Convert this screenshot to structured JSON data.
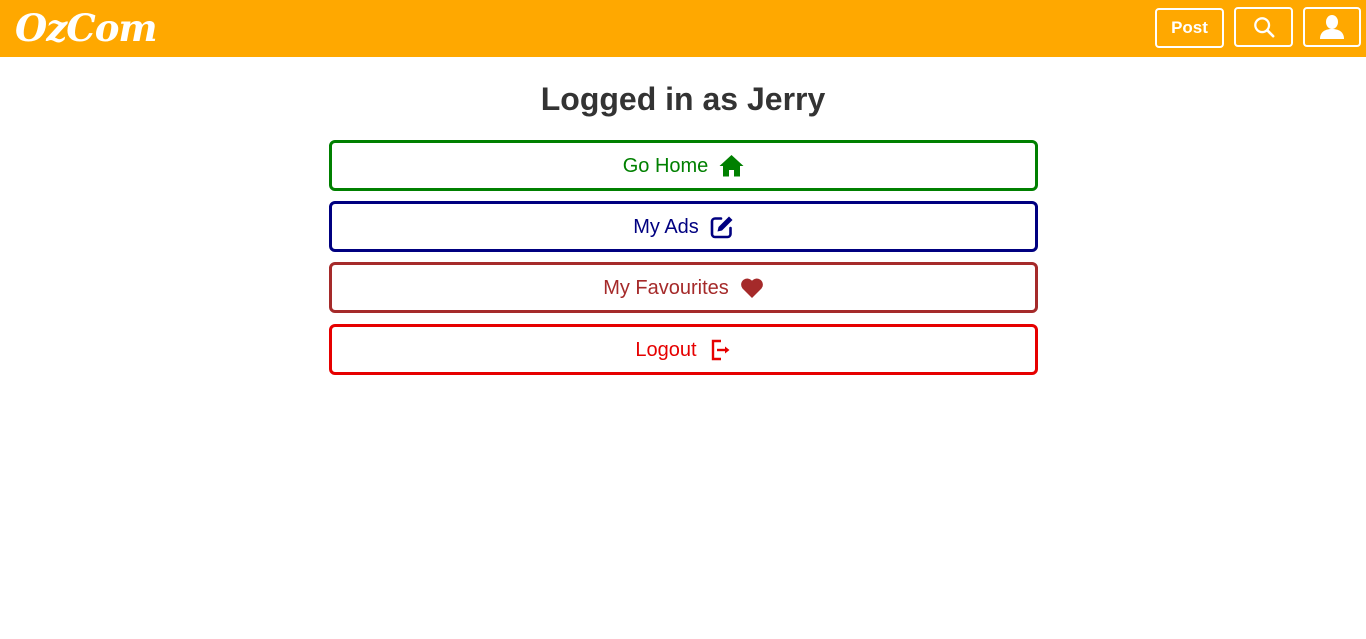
{
  "header": {
    "logo": "OzCom",
    "post_label": "Post",
    "search_icon": "search-icon",
    "user_icon": "user-icon",
    "background_color": "#FFA800"
  },
  "main": {
    "title": "Logged in as Jerry",
    "buttons": [
      {
        "label": "Go Home",
        "icon": "home-icon",
        "color": "#008000"
      },
      {
        "label": "My Ads",
        "icon": "edit-icon",
        "color": "#000080"
      },
      {
        "label": "My Favourites",
        "icon": "heart-icon",
        "color": "#A52A2A"
      },
      {
        "label": "Logout",
        "icon": "logout-icon",
        "color": "#E60000"
      }
    ]
  }
}
